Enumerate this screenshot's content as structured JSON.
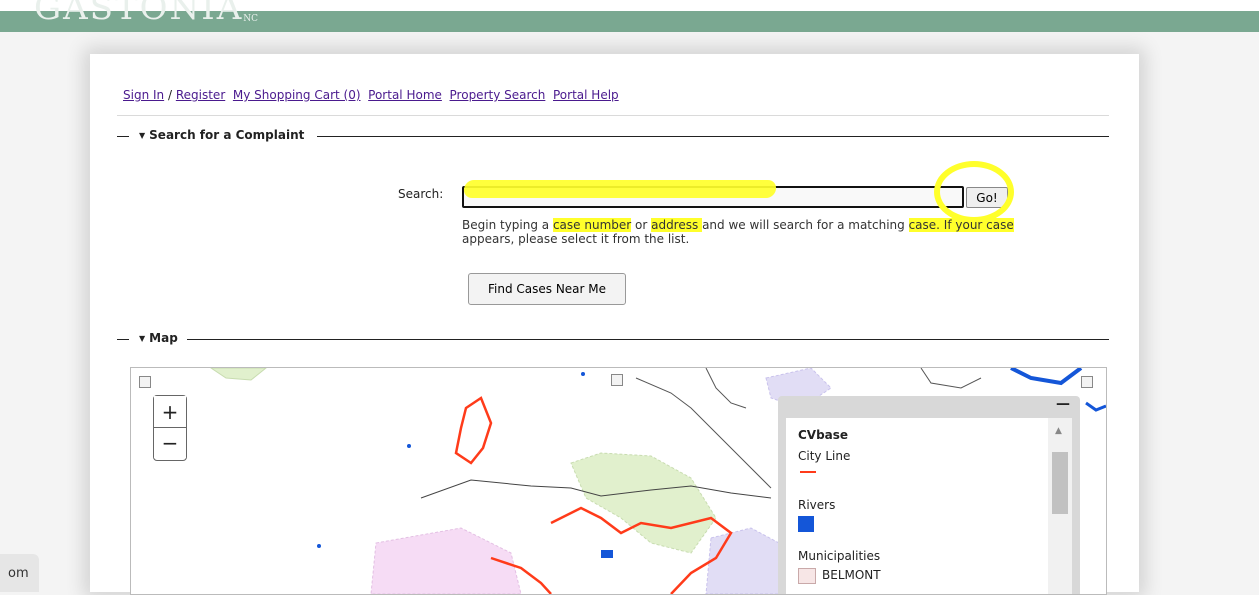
{
  "header": {
    "logo_text": "GASTONIA",
    "logo_suffix": "NC"
  },
  "nav": {
    "sign_in": "Sign In",
    "sep": "/",
    "register": "Register",
    "cart": "My Shopping Cart (0)",
    "portal_home": "Portal Home",
    "property_search": "Property Search",
    "portal_help": "Portal Help"
  },
  "complaint": {
    "title": "Search for a Complaint",
    "search_label": "Search:",
    "search_value": "",
    "go_label": "Go!",
    "hint": {
      "p1": "Begin typing a ",
      "k1": "case number",
      "p2": " or ",
      "k2": "address ",
      "p3": "and we will search for a matching ",
      "k3": "case. If your case",
      "p4": " appears, please select it from the list."
    },
    "near_me_label": "Find Cases Near Me"
  },
  "map": {
    "title": "Map",
    "zoom_in": "+",
    "zoom_out": "−",
    "legend": {
      "minimize": "—",
      "layer_title": "CVbase",
      "items": [
        "City Line",
        "Rivers",
        "Municipalities",
        "BELMONT"
      ]
    },
    "colors": {
      "city_line": "#ff3b1a",
      "rivers": "#1456d8",
      "municipality_belmont": "#f7e6e6",
      "municipality_pink": "#f6dcf5",
      "municipality_green": "#e1f0cd",
      "municipality_lavender": "#e1ddf5"
    }
  },
  "footer": {
    "tab_text": "om"
  }
}
